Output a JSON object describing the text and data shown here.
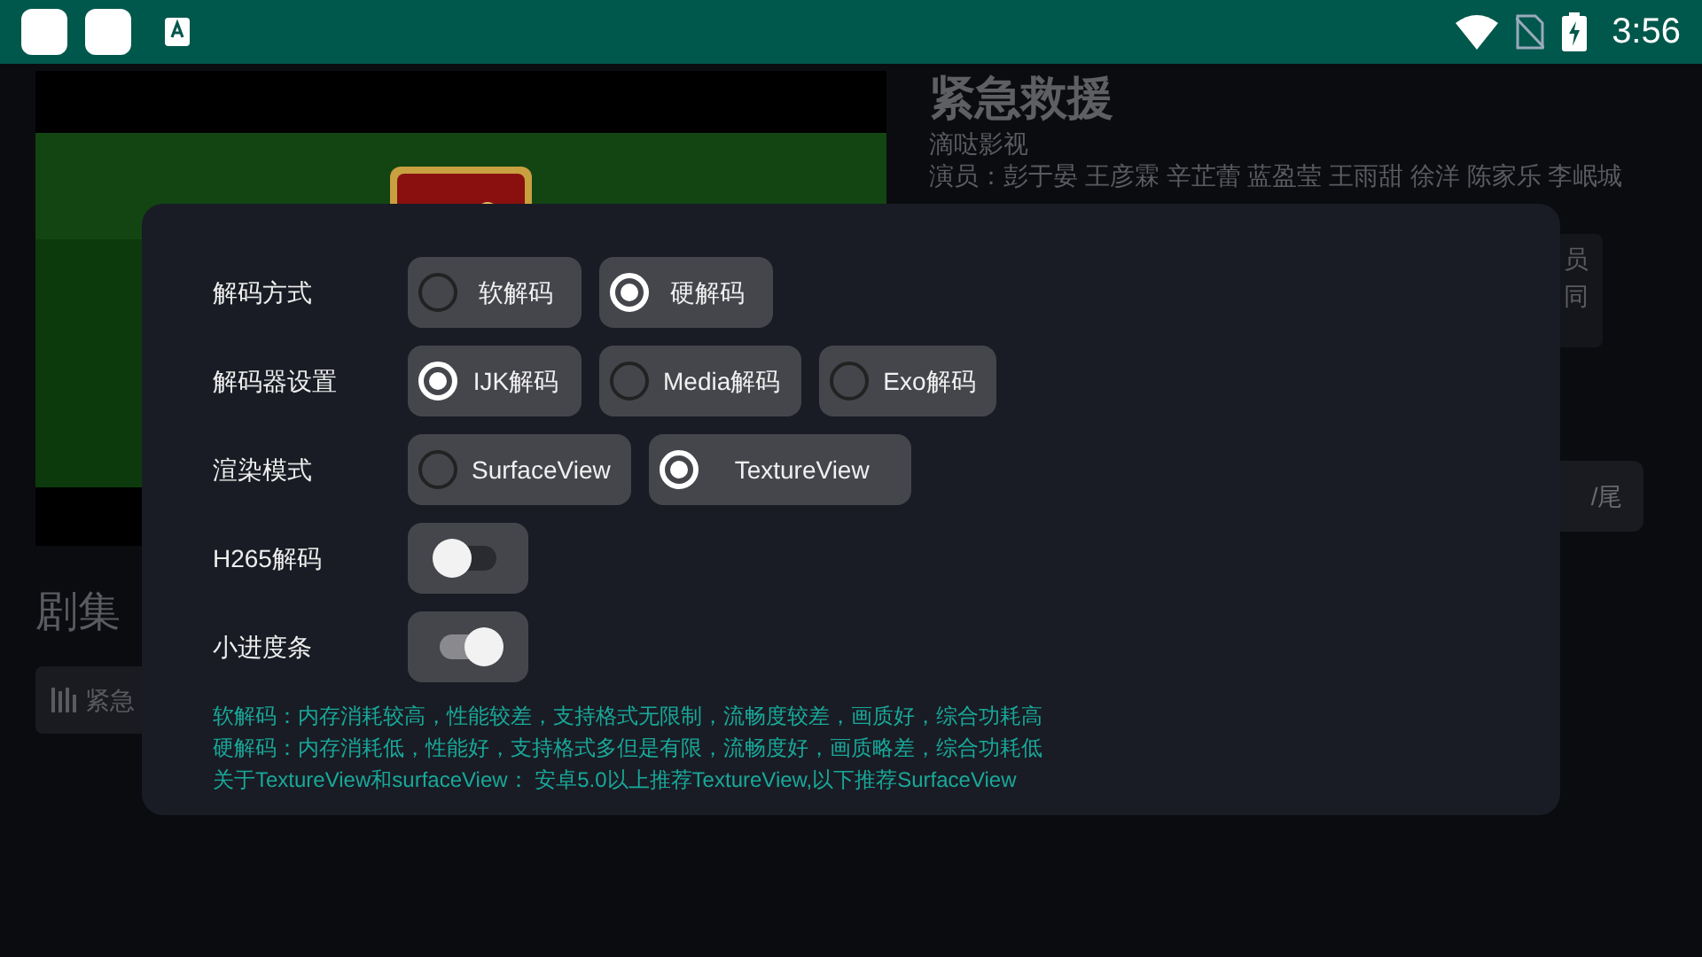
{
  "status_bar": {
    "time": "3:56"
  },
  "detail": {
    "title": "紧急救援",
    "source": "滴哒影视",
    "cast": "演员：彭于晏 王彦霖 辛芷蕾 蓝盈莹 王雨甜 徐洋 陈家乐 李岷城",
    "description_lines": [
      "员",
      "同"
    ],
    "button_fragment": "/尾",
    "section_title": "剧集",
    "episode": "紧急"
  },
  "dialog": {
    "rows": [
      {
        "kind": "radio",
        "label": "解码方式",
        "options": [
          {
            "label": "软解码",
            "selected": false
          },
          {
            "label": "硬解码",
            "selected": true
          }
        ]
      },
      {
        "kind": "radio",
        "label": "解码器设置",
        "options": [
          {
            "label": "IJK解码",
            "selected": true
          },
          {
            "label": "Media解码",
            "selected": false
          },
          {
            "label": "Exo解码",
            "selected": false
          }
        ]
      },
      {
        "kind": "radio",
        "label": "渲染模式",
        "options": [
          {
            "label": "SurfaceView",
            "selected": false
          },
          {
            "label": "TextureView",
            "selected": true
          }
        ]
      },
      {
        "kind": "switch",
        "label": "H265解码",
        "on": false
      },
      {
        "kind": "switch",
        "label": "小进度条",
        "on": true
      }
    ],
    "notes": [
      "软解码：内存消耗较高，性能较差，支持格式无限制，流畅度较差，画质好，综合功耗高",
      "硬解码：内存消耗低，性能好，支持格式多但是有限，流畅度好，画质略差，综合功耗低",
      "关于TextureView和surfaceView： 安卓5.0以上推荐TextureView,以下推荐SurfaceView"
    ]
  }
}
